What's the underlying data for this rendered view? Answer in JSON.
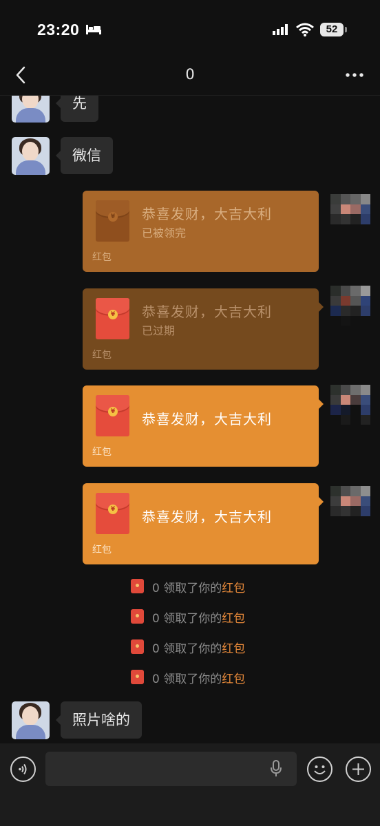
{
  "status_bar": {
    "time": "23:20",
    "battery": "52",
    "icons": [
      "bed-icon",
      "signal-icon",
      "wifi-icon",
      "battery-icon"
    ]
  },
  "nav": {
    "title": "0",
    "back_icon": "chevron-left-icon",
    "more_icon": "more-dots-icon"
  },
  "messages": {
    "incoming_1": "先",
    "incoming_2": "微信",
    "incoming_3": "照片啥的"
  },
  "red_packets": [
    {
      "title": "恭喜发财，大吉大利",
      "status": "已被领完",
      "footer": "红包",
      "state": "opened"
    },
    {
      "title": "恭喜发财，大吉大利",
      "status": "已过期",
      "footer": "红包",
      "state": "expired"
    },
    {
      "title": "恭喜发财，大吉大利",
      "status": "",
      "footer": "红包",
      "state": "active"
    },
    {
      "title": "恭喜发财，大吉大利",
      "status": "",
      "footer": "红包",
      "state": "active"
    }
  ],
  "notices": [
    {
      "prefix": "0 领取了你的",
      "link": "红包"
    },
    {
      "prefix": "0 领取了你的",
      "link": "红包"
    },
    {
      "prefix": "0 领取了你的",
      "link": "红包"
    },
    {
      "prefix": "0 领取了你的",
      "link": "红包"
    }
  ],
  "input": {
    "placeholder": "",
    "value": ""
  },
  "colors": {
    "packet_active": "#e58f32",
    "packet_opened": "#a8672a",
    "packet_expired": "#754a1e",
    "notice_link": "#e88a3a",
    "background": "#111111"
  }
}
